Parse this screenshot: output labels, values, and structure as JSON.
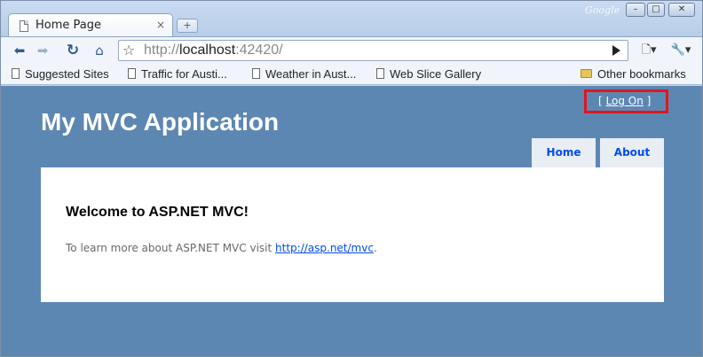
{
  "browser": {
    "tab_title": "Home Page",
    "tab_close": "×",
    "new_tab": "+",
    "watermark": "Google",
    "window_buttons": [
      "–",
      "□",
      "✕"
    ],
    "url_scheme": "http://",
    "url_host": "localhost",
    "url_rest": ":42420/",
    "toolbar_icons": [
      "back-icon",
      "forward-icon",
      "reload-icon",
      "home-icon",
      "star-icon",
      "go-icon",
      "page-menu-icon",
      "wrench-icon"
    ]
  },
  "bookmarks": {
    "items": [
      "Suggested Sites",
      "Traffic for Austi...",
      "Weather in Aust...",
      "Web Slice Gallery"
    ],
    "other": "Other bookmarks"
  },
  "site": {
    "title": "My MVC Application",
    "logon_open": "[",
    "logon_label": "Log On",
    "logon_close": "]",
    "menu": [
      "Home",
      "About"
    ],
    "heading": "Welcome to ASP.NET MVC!",
    "body_text": "To learn more about ASP.NET MVC visit ",
    "link_text": "http://asp.net/mvc",
    "body_end": "."
  },
  "colors": {
    "page_background": "#5c87b2",
    "menu_text": "#034af3",
    "highlight_box": "#e4151f"
  }
}
